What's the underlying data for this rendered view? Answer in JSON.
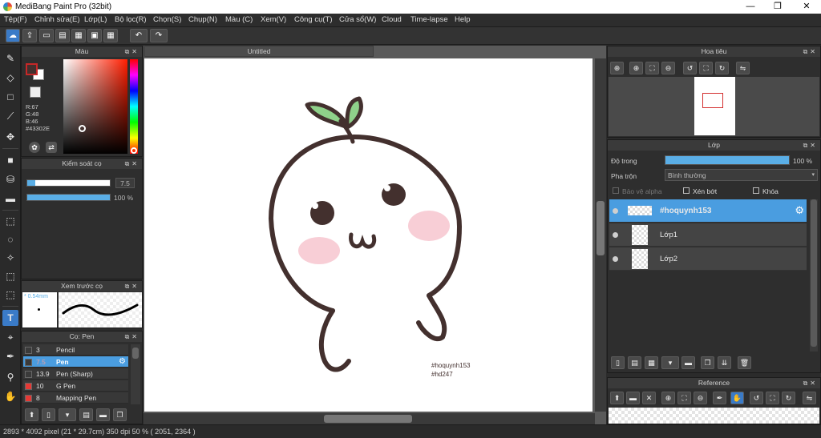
{
  "window": {
    "title": "MediBang Paint Pro (32bit)",
    "minimize": "—",
    "maximize": "❐",
    "close": "✕"
  },
  "menu": [
    "Tệp(F)",
    "Chỉnh sửa(E)",
    "Lớp(L)",
    "Bộ lọc(R)",
    "Chọn(S)",
    "Chụp(N)",
    "Màu (C)",
    "Xem(V)",
    "Công cụ(T)",
    "Cửa sổ(W)",
    "Cloud",
    "Time-lapse",
    "Help"
  ],
  "color_panel": {
    "title": "Màu",
    "r": "R:67",
    "g": "G:48",
    "b": "B:46",
    "hex": "#43302E",
    "fg_color": "#43302E",
    "bg_color": "#ffffff"
  },
  "brush_control": {
    "title": "Kiểm soát cọ",
    "size_value": "7.5",
    "opacity_value": "100 %",
    "size_fraction": 0.1,
    "opacity_fraction": 1.0
  },
  "brush_preview": {
    "title": "Xem trước cọ",
    "size_label": "* 0.54mm"
  },
  "brush_panel": {
    "title": "Cọ: Pen",
    "items": [
      {
        "size": "3",
        "name": "Pencil",
        "swatch": "#3a3a3a"
      },
      {
        "size": "7.5",
        "name": "Pen",
        "swatch": "#3a3a3a",
        "selected": true
      },
      {
        "size": "13.9",
        "name": "Pen (Sharp)",
        "swatch": "#3a3a3a"
      },
      {
        "size": "10",
        "name": "G Pen",
        "swatch": "#e53935"
      },
      {
        "size": "8",
        "name": "Mapping Pen",
        "swatch": "#e53935"
      }
    ]
  },
  "canvas": {
    "tab": "Untitled",
    "text_line1": "#hoquynh153",
    "text_line2": "#hd247"
  },
  "navigator": {
    "title": "Hoa tiêu"
  },
  "layer_panel": {
    "title": "Lớp",
    "opacity_label": "Độ trong",
    "opacity_value": "100 %",
    "opacity_fraction": 1.0,
    "blend_label": "Pha trộn",
    "blend_value": "Bình thường",
    "protect_alpha": "Bảo vệ alpha",
    "clipping": "Xén bớt",
    "lock": "Khóa",
    "layers": [
      {
        "name": "#hoquynh153",
        "selected": true
      },
      {
        "name": "Lớp1"
      },
      {
        "name": "Lớp2"
      }
    ]
  },
  "reference": {
    "title": "Reference"
  },
  "status": {
    "text": "2893 * 4092 pixel   (21 * 29.7cm)   350 dpi   50 %   ( 2051, 2364 )"
  }
}
